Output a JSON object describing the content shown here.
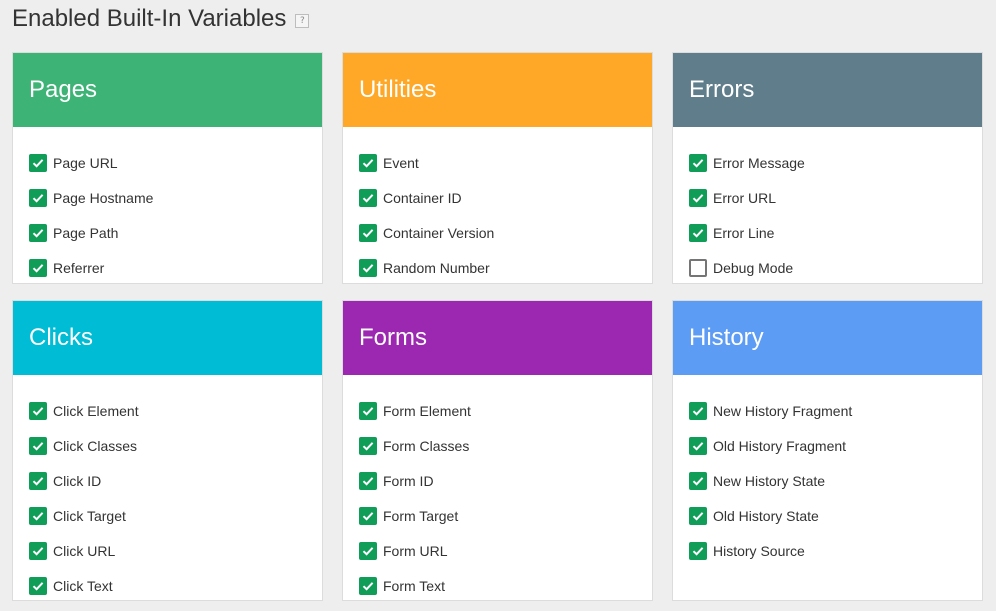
{
  "page": {
    "title": "Enabled Built-In Variables",
    "help_glyph": "?"
  },
  "colors": {
    "pages": "#3db376",
    "utilities": "#ffa726",
    "errors": "#607d8b",
    "clicks": "#00bcd4",
    "forms": "#9c27b0",
    "history": "#5c9cf5",
    "checkbox_checked": "#0f9d58"
  },
  "icons": {
    "checked": "checkbox-checked-icon",
    "unchecked": "checkbox-unchecked-icon",
    "help": "help-icon"
  },
  "cards": [
    {
      "id": "pages",
      "title": "Pages",
      "items": [
        {
          "label": "Page URL",
          "checked": true
        },
        {
          "label": "Page Hostname",
          "checked": true
        },
        {
          "label": "Page Path",
          "checked": true
        },
        {
          "label": "Referrer",
          "checked": true
        }
      ]
    },
    {
      "id": "utilities",
      "title": "Utilities",
      "items": [
        {
          "label": "Event",
          "checked": true
        },
        {
          "label": "Container ID",
          "checked": true
        },
        {
          "label": "Container Version",
          "checked": true
        },
        {
          "label": "Random Number",
          "checked": true
        }
      ]
    },
    {
      "id": "errors",
      "title": "Errors",
      "items": [
        {
          "label": "Error Message",
          "checked": true
        },
        {
          "label": "Error URL",
          "checked": true
        },
        {
          "label": "Error Line",
          "checked": true
        },
        {
          "label": "Debug Mode",
          "checked": false
        }
      ]
    },
    {
      "id": "clicks",
      "title": "Clicks",
      "items": [
        {
          "label": "Click Element",
          "checked": true
        },
        {
          "label": "Click Classes",
          "checked": true
        },
        {
          "label": "Click ID",
          "checked": true
        },
        {
          "label": "Click Target",
          "checked": true
        },
        {
          "label": "Click URL",
          "checked": true
        },
        {
          "label": "Click Text",
          "checked": true
        }
      ]
    },
    {
      "id": "forms",
      "title": "Forms",
      "items": [
        {
          "label": "Form Element",
          "checked": true
        },
        {
          "label": "Form Classes",
          "checked": true
        },
        {
          "label": "Form ID",
          "checked": true
        },
        {
          "label": "Form Target",
          "checked": true
        },
        {
          "label": "Form URL",
          "checked": true
        },
        {
          "label": "Form Text",
          "checked": true
        }
      ]
    },
    {
      "id": "history",
      "title": "History",
      "items": [
        {
          "label": "New History Fragment",
          "checked": true
        },
        {
          "label": "Old History Fragment",
          "checked": true
        },
        {
          "label": "New History State",
          "checked": true
        },
        {
          "label": "Old History State",
          "checked": true
        },
        {
          "label": "History Source",
          "checked": true
        }
      ]
    }
  ]
}
